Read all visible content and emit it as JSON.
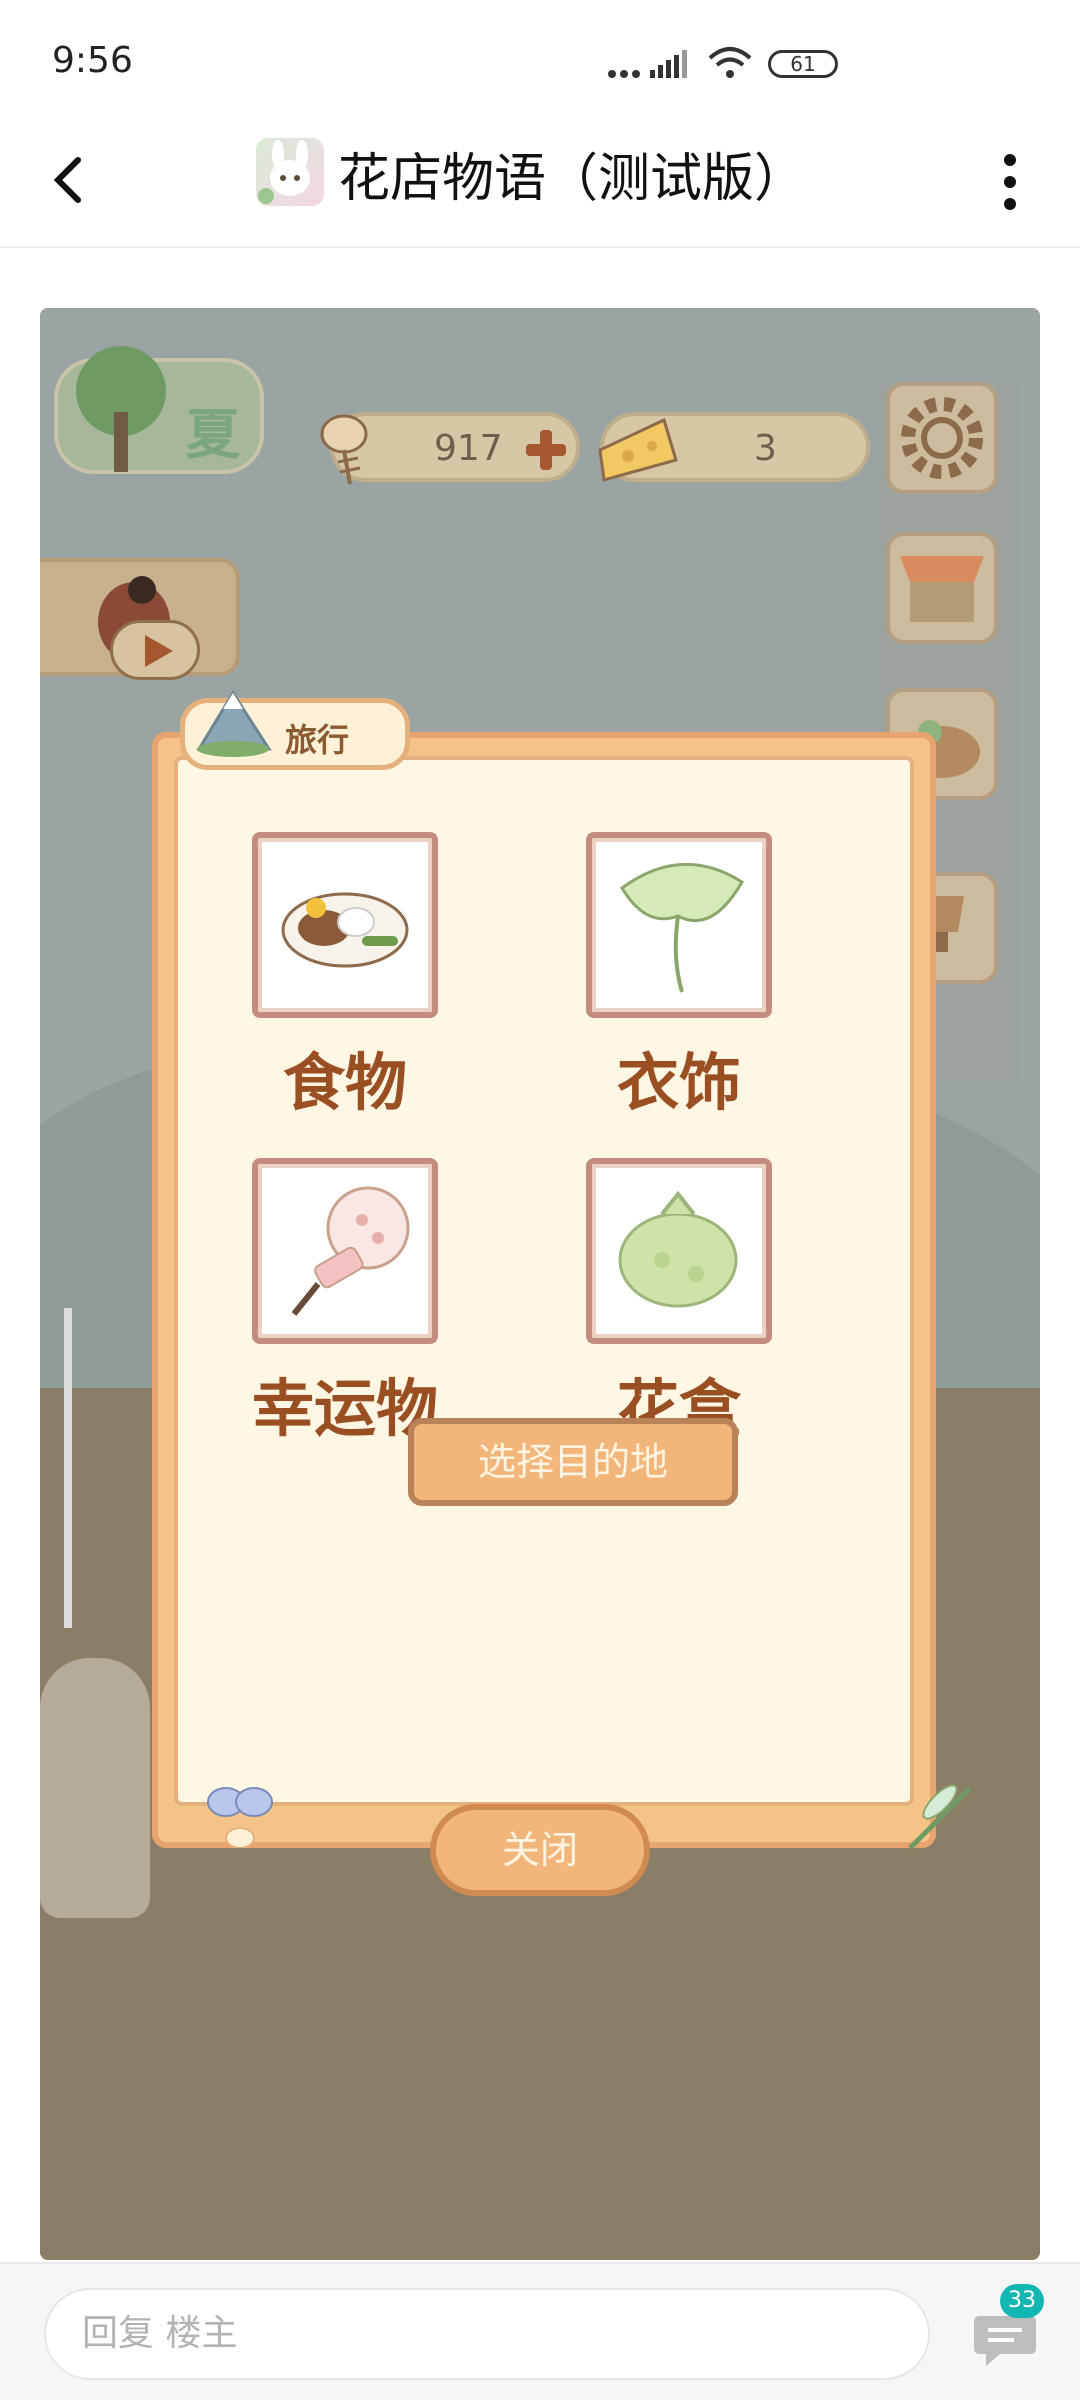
{
  "status_bar": {
    "time": "9:56",
    "battery": "61"
  },
  "header": {
    "title": "花店物语（测试版）"
  },
  "game": {
    "season": "夏",
    "resources": {
      "fish_count": "917",
      "cheese_count": "3"
    },
    "modal": {
      "tab_label": "旅行",
      "items": [
        {
          "label": "食物",
          "icon": "food-plate-icon"
        },
        {
          "label": "衣饰",
          "icon": "leaf-hat-icon"
        },
        {
          "label": "幸运物",
          "icon": "lucky-charm-icon"
        },
        {
          "label": "花盒",
          "icon": "flower-box-icon"
        }
      ],
      "select_button": "选择目的地",
      "close_button": "关闭"
    }
  },
  "footer": {
    "reply_placeholder": "回复 楼主",
    "comment_count": "33"
  },
  "colors": {
    "accent": "#12b7b3",
    "modal_orange": "#f4c387",
    "label_brown": "#9a4f23"
  }
}
